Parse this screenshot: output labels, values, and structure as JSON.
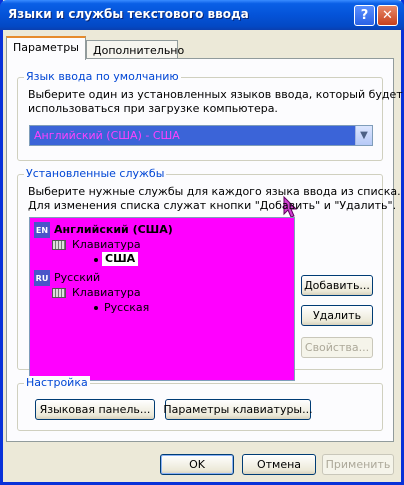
{
  "window": {
    "title": "Языки и службы текстового ввода",
    "help_glyph": "?",
    "close_glyph": "✕"
  },
  "tabs": [
    {
      "label": "Параметры",
      "active": true
    },
    {
      "label": "Дополнительно",
      "active": false
    }
  ],
  "default_lang": {
    "legend": "Язык ввода по умолчанию",
    "desc_line1": "Выберите один из установленных языков ввода, который будет",
    "desc_line2": "использоваться при загрузке компьютера.",
    "selected": "Английский (США) - США"
  },
  "services": {
    "legend": "Установленные службы",
    "desc_line1": "Выберите нужные службы для каждого языка ввода из списка.",
    "desc_line2": "Для изменения списка служат кнопки \"Добавить\" и \"Удалить\".",
    "tree": {
      "lang1": {
        "icon": "EN",
        "label": "Английский (США)"
      },
      "lang1_kb": "Клавиатура",
      "lang1_layout": "США",
      "lang2": {
        "icon": "RU",
        "label": "Русский"
      },
      "lang2_kb": "Клавиатура",
      "lang2_layout": "Русская"
    },
    "buttons": {
      "add": "Добавить...",
      "remove": "Удалить",
      "properties": "Свойства..."
    }
  },
  "settings": {
    "legend": "Настройка",
    "language_bar": "Языковая панель...",
    "key_settings": "Параметры клавиатуры..."
  },
  "footer": {
    "ok": "OK",
    "cancel": "Отмена",
    "apply": "Применить"
  },
  "colors": {
    "title_bar": "#0453d8",
    "group_legend": "#0046d5",
    "list_background": "#ff00ff",
    "selected_text": "#ff40ff"
  }
}
